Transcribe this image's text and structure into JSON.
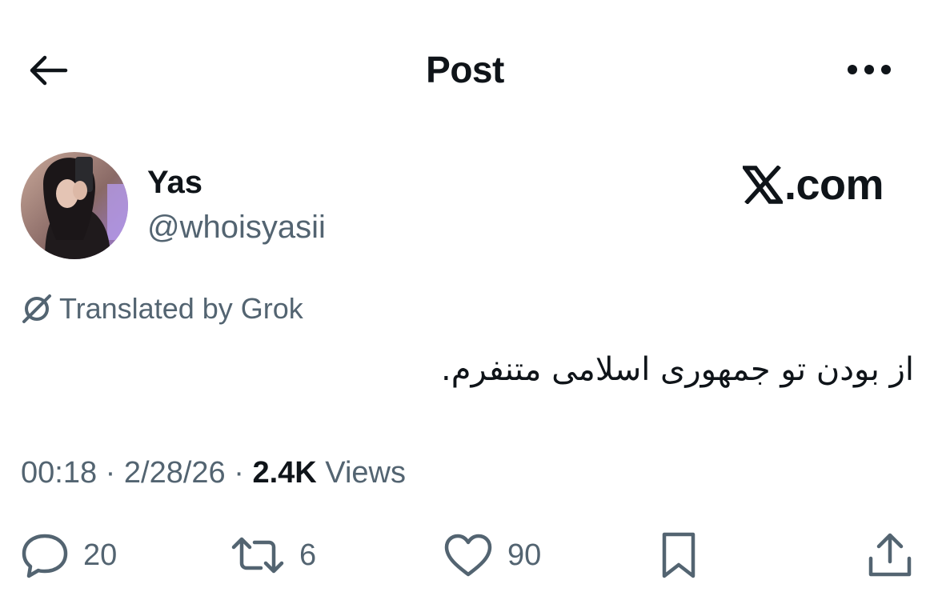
{
  "header": {
    "title": "Post",
    "back_icon": "arrow-left-icon",
    "more_icon": "more-horizontal-icon"
  },
  "author": {
    "display_name": "Yas",
    "handle": "@whoisyasii",
    "avatar_icon": "avatar"
  },
  "watermark": {
    "logo": "x-logo-icon",
    "text": ".com"
  },
  "translation": {
    "label": "Translated by Grok",
    "icon": "grok-icon"
  },
  "post": {
    "text": "از      بودن تو جمهوری اسلامی متنفرم."
  },
  "meta": {
    "time": "00:18",
    "sep1": " · ",
    "date": "2/28/26",
    "sep2": " · ",
    "views_count": "2.4K",
    "views_label": " Views"
  },
  "actions": {
    "replies": "20",
    "reposts": "6",
    "likes": "90"
  },
  "colors": {
    "text": "#0f1419",
    "secondary": "#536471",
    "background": "#ffffff"
  }
}
